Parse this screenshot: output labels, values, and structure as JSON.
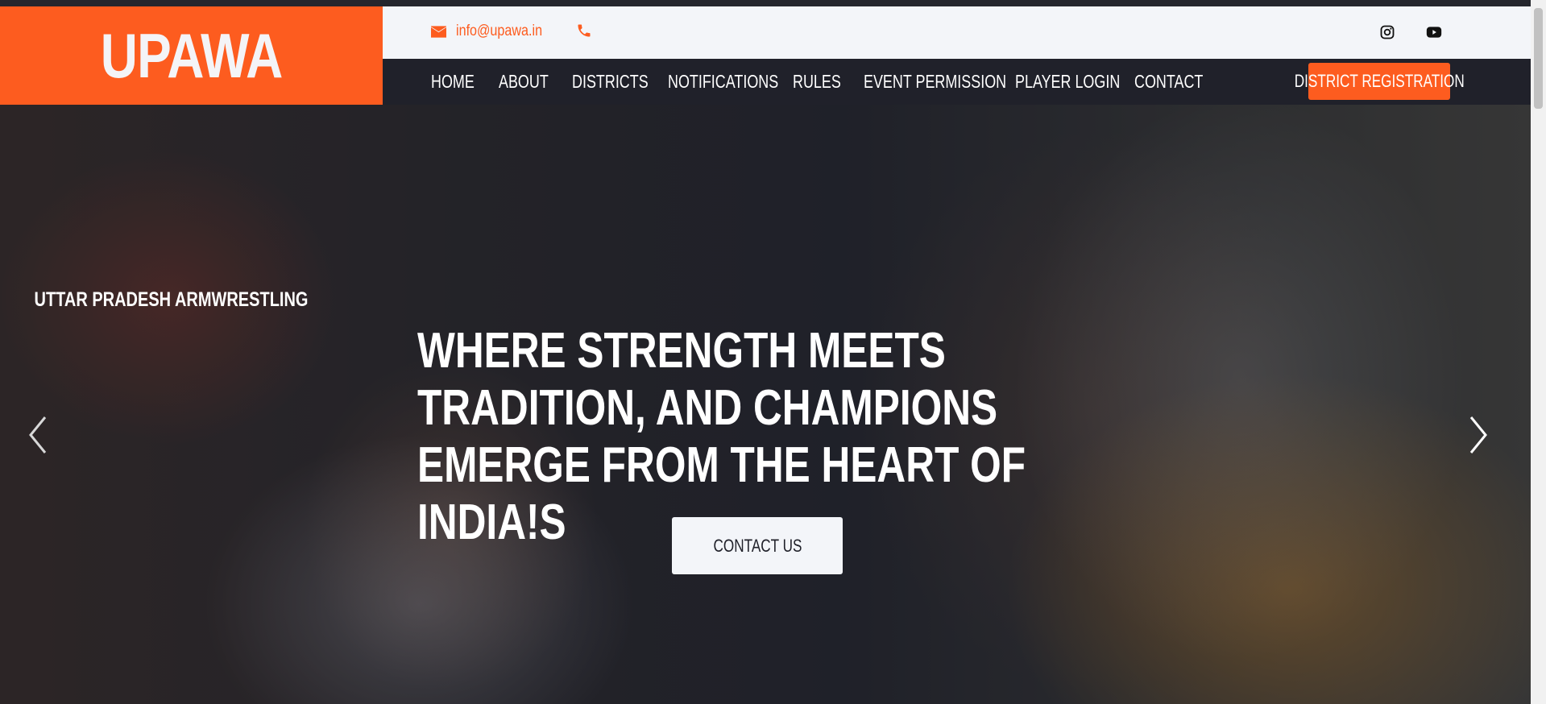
{
  "brand": {
    "logo_text": "UPAWA",
    "accent_color": "#fd5c1f",
    "dark_color": "#20212a"
  },
  "topbar": {
    "email": "info@upawa.in",
    "mail_icon": "envelope-icon",
    "phone_icon": "phone-icon",
    "social": [
      {
        "icon": "instagram-icon"
      },
      {
        "icon": "youtube-icon"
      }
    ]
  },
  "nav": {
    "items": [
      {
        "label": "HOME"
      },
      {
        "label": "ABOUT"
      },
      {
        "label": "DISTRICTS"
      },
      {
        "label": "NOTIFICATIONS"
      },
      {
        "label": "RULES"
      },
      {
        "label": "EVENT PERMISSION"
      },
      {
        "label": "PLAYER LOGIN"
      },
      {
        "label": "CONTACT"
      }
    ],
    "cta_label": "DISTRICT REGISTRATION"
  },
  "hero": {
    "kicker": "UTTAR PRADESH ARMWRESTLING",
    "title": "WHERE STRENGTH MEETS TRADITION, AND CHAMPIONS EMERGE FROM THE HEART OF INDIA!S",
    "button_label": "CONTACT US",
    "prev_icon": "chevron-left-icon",
    "next_icon": "chevron-right-icon"
  }
}
